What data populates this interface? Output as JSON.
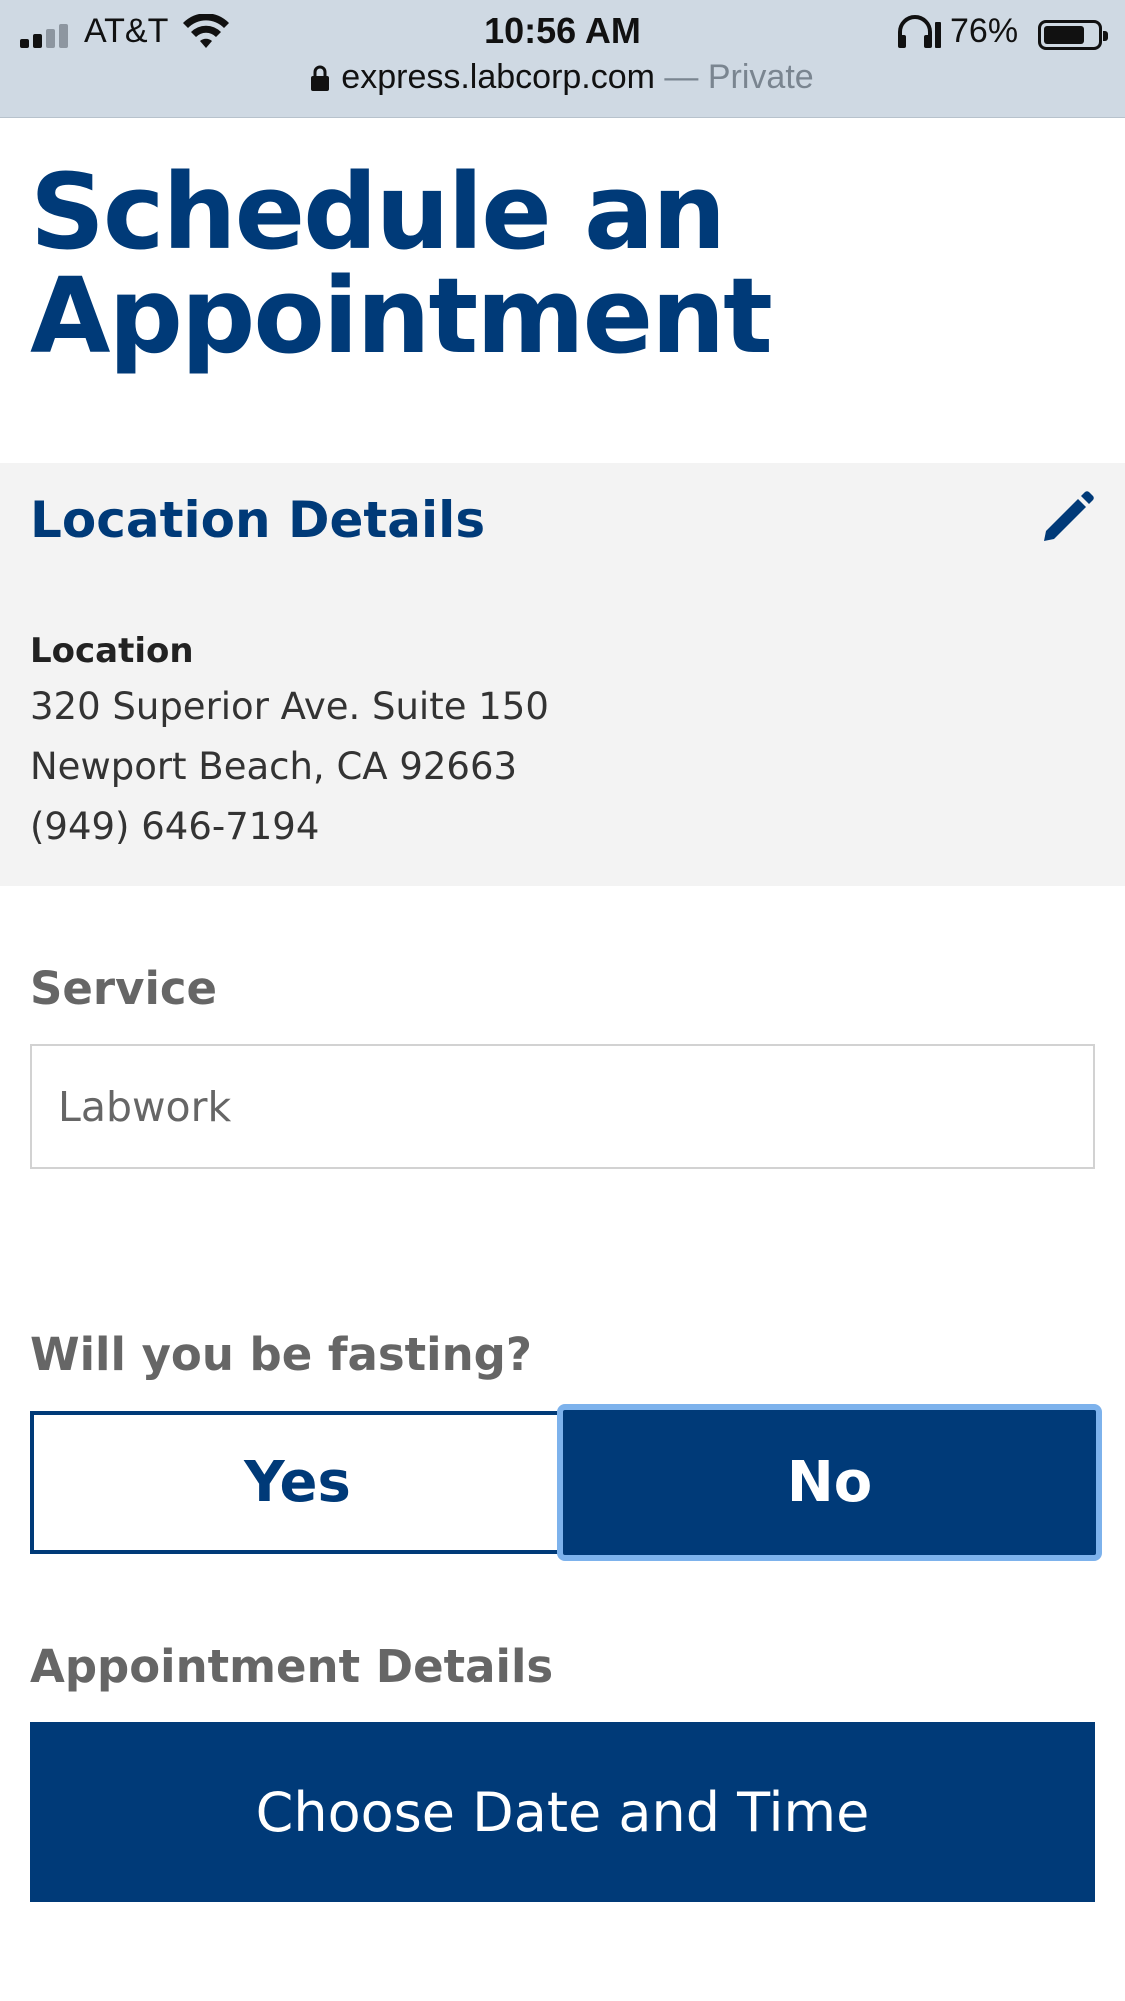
{
  "status_bar": {
    "carrier": "AT&T",
    "time": "10:56 AM",
    "battery_percent": "76%",
    "battery_level": 0.76,
    "signal_icon": "signal-bars-icon",
    "wifi_icon": "wifi-icon",
    "headphones_icon": "headphones-icon"
  },
  "browser": {
    "url": "express.labcorp.com",
    "private_label": " — Private"
  },
  "page": {
    "title_line1": "Schedule an",
    "title_line2": "Appointment"
  },
  "location": {
    "heading": "Location Details",
    "label": "Location",
    "address_line1": "320 Superior Ave. Suite 150",
    "address_line2": "Newport Beach, CA 92663",
    "phone": "(949) 646-7194"
  },
  "service": {
    "label": "Service",
    "value": "Labwork"
  },
  "fasting": {
    "question": "Will you be fasting?",
    "yes_label": "Yes",
    "no_label": "No",
    "selected": "No"
  },
  "appointment": {
    "label": "Appointment Details",
    "button_label": "Choose Date and Time"
  },
  "colors": {
    "brand_blue": "#003a78",
    "focus_blue": "#7db2ec",
    "panel_gray": "#f3f3f3"
  }
}
